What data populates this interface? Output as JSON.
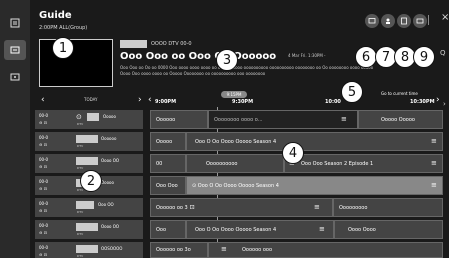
{
  "header": {
    "title": "Guide",
    "subtitle": "2:00PM  ALL(Group)"
  },
  "preview": {
    "channel_line": "OOOO DTV 00-0",
    "program_title": "Ooo Ooo oo Ooo Oo    Oooooo",
    "date_time": "4 Mar Fri. 1:30PM -",
    "description": "Ooo Ooo oo Oo oo 0000 Ooo oooo oooo oooo oo oooooooooo oooooooooo oooooooooo oooooooo oo Oo oooooooo oooo ooooo Oooo Ooo oooo oooo oo Ooooo Oooooooo oo oooooooooo ooo oooooooo"
  },
  "top_icons": [
    {
      "icon": "record-icon"
    },
    {
      "icon": "person-icon"
    },
    {
      "icon": "filter-icon"
    },
    {
      "icon": "screen-icon"
    }
  ],
  "close_label": "×",
  "timeline": {
    "today_label": "TODAY",
    "times": [
      "9:00PM",
      "9:30PM",
      "10:00",
      "10:30PM"
    ],
    "now_label": "9:15PM",
    "current_time_label": "Go to current time"
  },
  "channels": [
    {
      "number": "00-0",
      "name": "Ooooo",
      "sub": "DTV"
    },
    {
      "number": "00-0",
      "name": "Oooooo",
      "sub": "DTV"
    },
    {
      "number": "00-0",
      "name": "Oooo OO",
      "sub": "DTV"
    },
    {
      "number": "00-0",
      "name": "Ooooo",
      "sub": "DTV"
    },
    {
      "number": "00-0",
      "name": "Ooo OO",
      "sub": "DTV"
    },
    {
      "number": "00-0",
      "name": "Oooo OO",
      "sub": "DTV"
    },
    {
      "number": "00-0",
      "name": "OOSOOOO",
      "sub": "DTV"
    }
  ],
  "programs": [
    [
      {
        "title": "Oooooo"
      },
      {
        "title": "Oooooooo oooo o..."
      },
      {
        "title": "Ooooo Ooooo"
      }
    ],
    [
      {
        "title": "Ooooo"
      },
      {
        "title": "Ooo O Oo Oooo Ooooo Season 4"
      }
    ],
    [
      {
        "title": "00"
      },
      {
        "title": "Oooooooooo"
      },
      {
        "title": "Ooo Ooo Season 2 Episode 1"
      }
    ],
    [
      {
        "title": "Ooo Ooo"
      },
      {
        "title": "Ooo O Oo Oooo Ooooo Season 4"
      }
    ],
    [
      {
        "title": "Oooooo oo 3"
      },
      {
        "title": "Ooooooooo"
      }
    ],
    [
      {
        "title": "Ooo"
      },
      {
        "title": "Ooo O Oo Oooo Ooooo Season 4"
      },
      {
        "title": "Oooo Oooo"
      }
    ],
    [
      {
        "title": "Oooooo oo 3o"
      },
      {
        "title": "Oooooo ooo"
      }
    ]
  ],
  "callouts": [
    "1",
    "2",
    "3",
    "4",
    "5",
    "6",
    "7",
    "8",
    "9"
  ]
}
